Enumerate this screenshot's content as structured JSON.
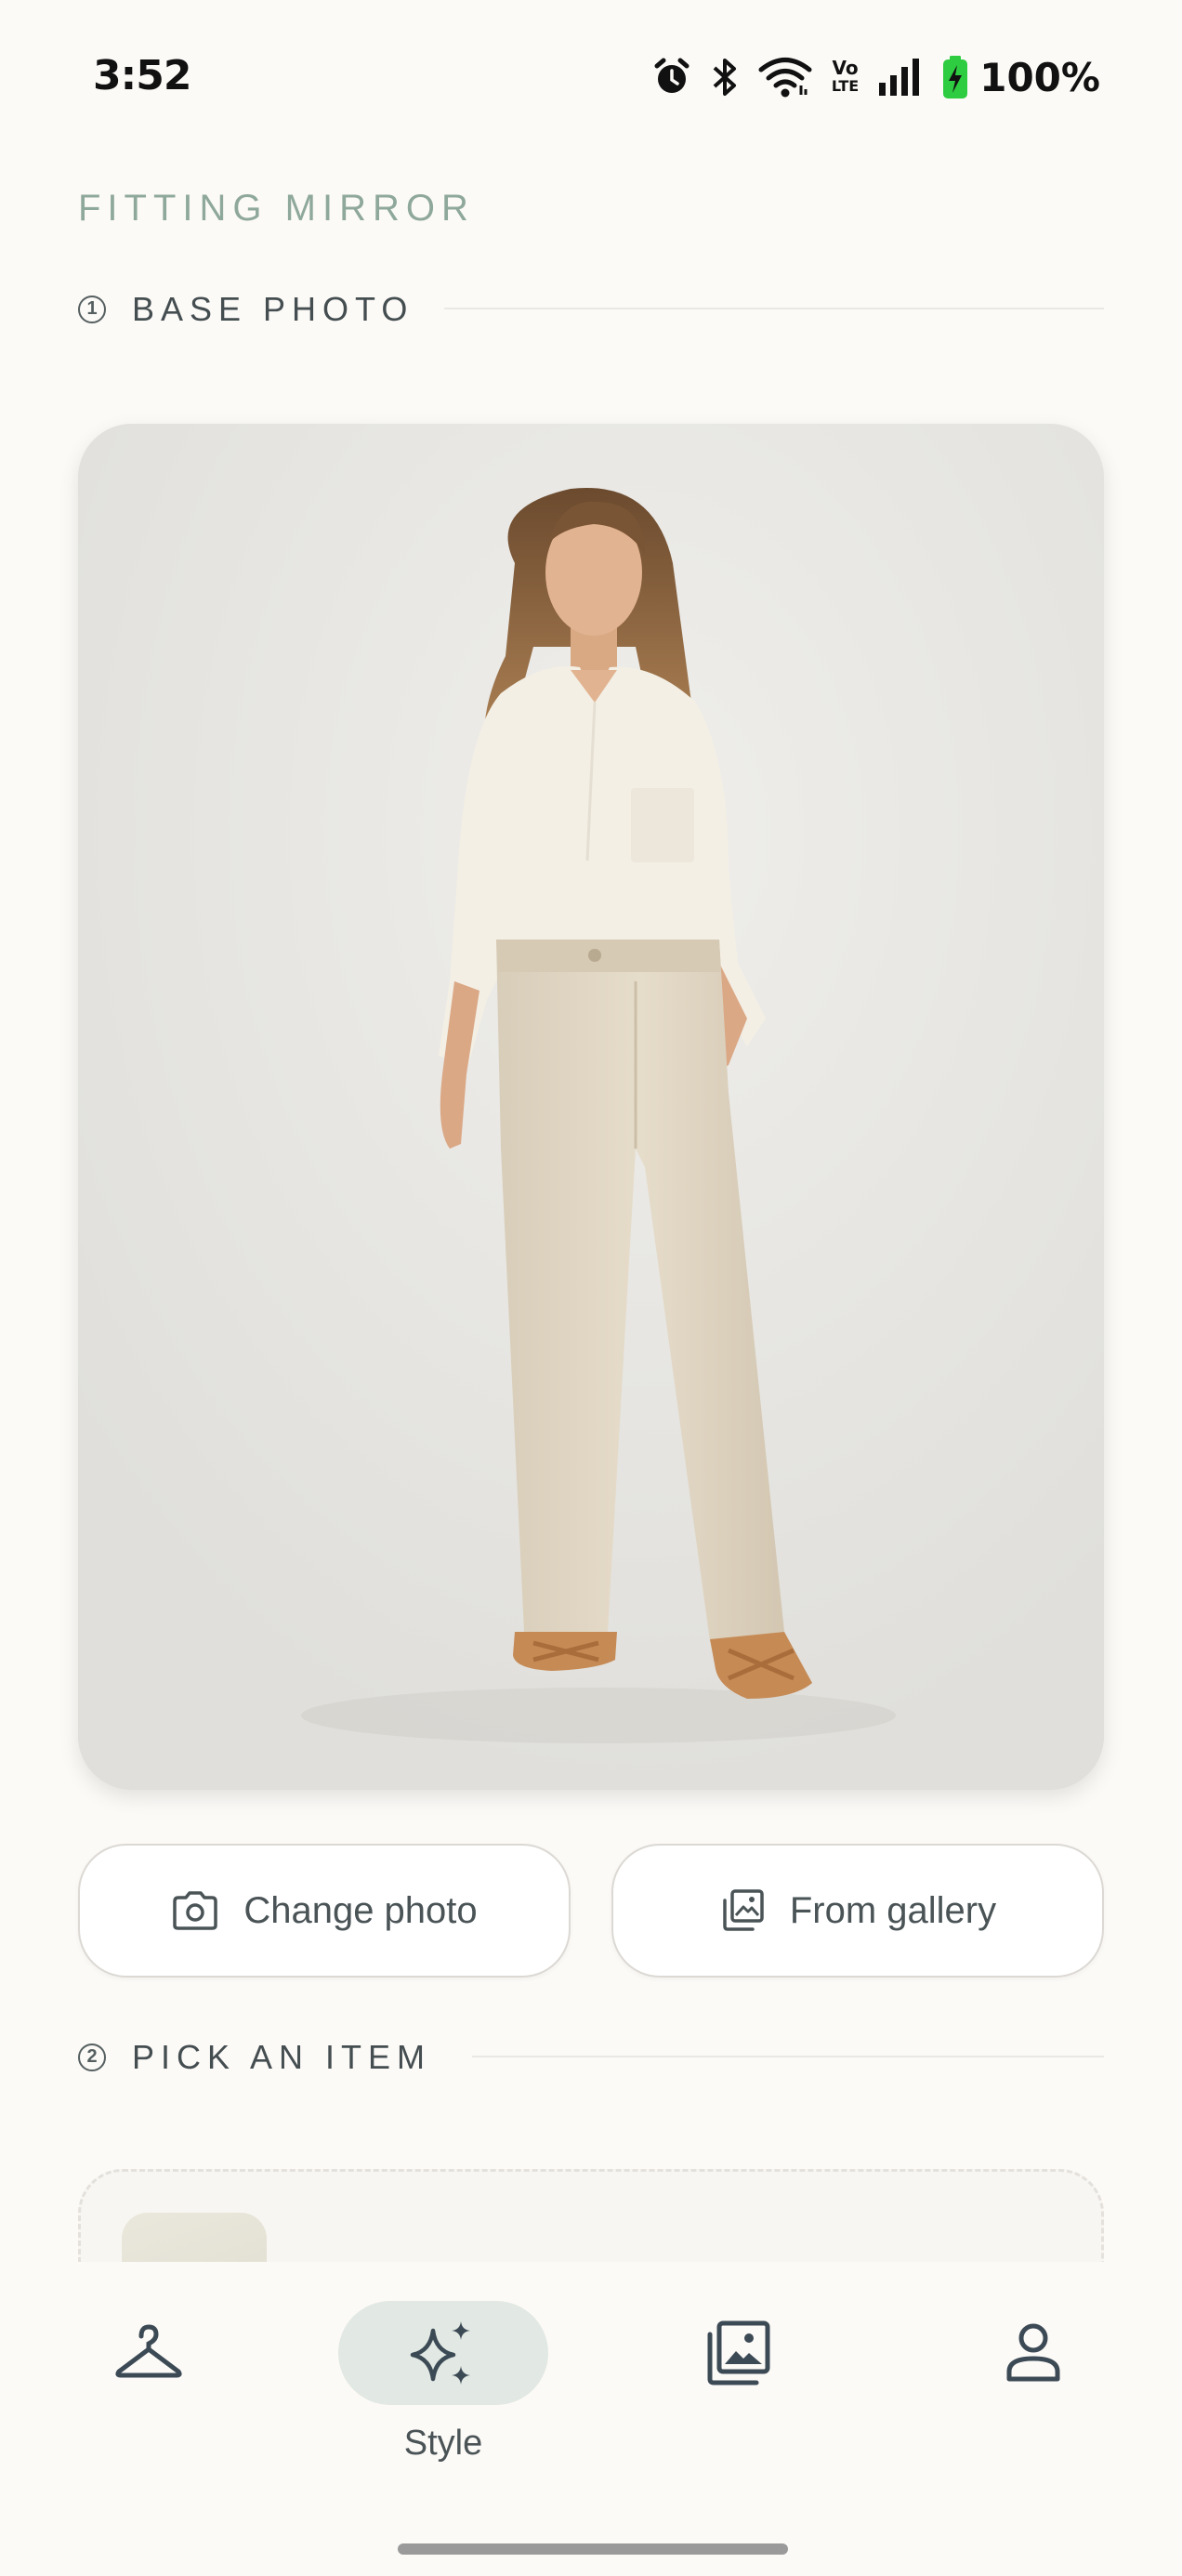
{
  "status_bar": {
    "time": "3:52",
    "icons": [
      "alarm-icon",
      "bluetooth-icon",
      "wifi-icon",
      "volte-icon",
      "signal-icon",
      "battery-charging-icon"
    ],
    "volte_top": "Vo",
    "volte_bottom": "LTE",
    "battery": "100%",
    "battery_color": "#2ecc40"
  },
  "app": {
    "title": "FITTING MIRROR",
    "accent": "#8fa89c"
  },
  "sections": {
    "base_photo": {
      "number": "1",
      "label": "BASE PHOTO"
    },
    "pick_item": {
      "number": "2",
      "label": "PICK AN ITEM"
    }
  },
  "photo": {
    "subject": "photo-of-woman-in-cream-shirt-and-beige-jeans"
  },
  "actions": {
    "change_photo": {
      "label": "Change photo",
      "icon": "camera-icon"
    },
    "from_gallery": {
      "label": "From gallery",
      "icon": "gallery-icon"
    }
  },
  "bottom_nav": {
    "items": [
      {
        "id": "wardrobe",
        "icon": "hanger-icon",
        "label": ""
      },
      {
        "id": "style",
        "icon": "sparkles-icon",
        "label": "Style",
        "active": true
      },
      {
        "id": "gallery",
        "icon": "photo-library-icon",
        "label": ""
      },
      {
        "id": "profile",
        "icon": "person-icon",
        "label": ""
      }
    ],
    "active_pill_color": "#e2e8e3"
  }
}
